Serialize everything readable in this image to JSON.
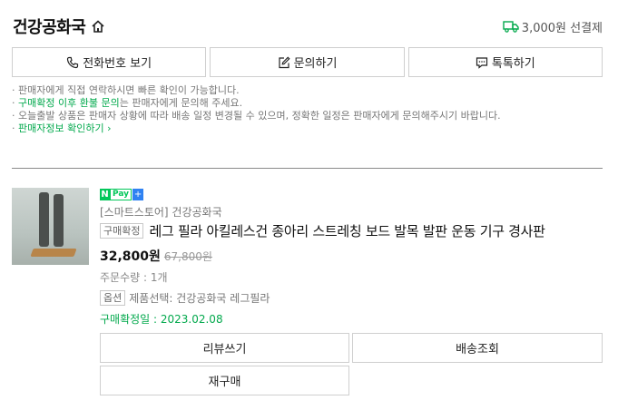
{
  "header": {
    "store_name": "건강공화국",
    "shipping_text": "3,000원 선결제"
  },
  "actions": {
    "phone": "전화번호 보기",
    "inquiry": "문의하기",
    "talk": "톡톡하기"
  },
  "notice": {
    "line1": "판매자에게 직접 연락하시면 빠른 확인이 가능합니다.",
    "line2_highlight": "구매확정 이후 환불 문의",
    "line2_rest": "는 판매자에게 문의해 주세요.",
    "line3": "오늘출발 상품은 판매자 상황에 따라 배송 일정 변경될 수 있으며, 정확한 일정은 판매자에게 문의해주시기 바랍니다.",
    "line4_link": "판매자정보 확인하기",
    "line4_arrow": "›"
  },
  "product": {
    "npay_n": "N",
    "npay_pay": "Pay",
    "npay_plus": "+",
    "store_tag": "[스마트스토어] 건강공화국",
    "status_badge": "구매확정",
    "title": "레그 필라 아킬레스건 종아리 스트레칭 보드 발목 발판 운동 기구 경사판",
    "price": "32,800원",
    "original_price": "67,800원",
    "quantity": "주문수량 : 1개",
    "option_badge": "옵션",
    "option_text": "제품선택: 건강공화국 레그필라",
    "confirm_date": "구매확정일 : 2023.02.08"
  },
  "buttons": {
    "review": "리뷰쓰기",
    "tracking": "배송조회",
    "reorder": "재구매"
  },
  "colors": {
    "accent_green": "#03a94d",
    "npay_green": "#03c75a",
    "npay_plus_blue": "#2f82f2"
  }
}
